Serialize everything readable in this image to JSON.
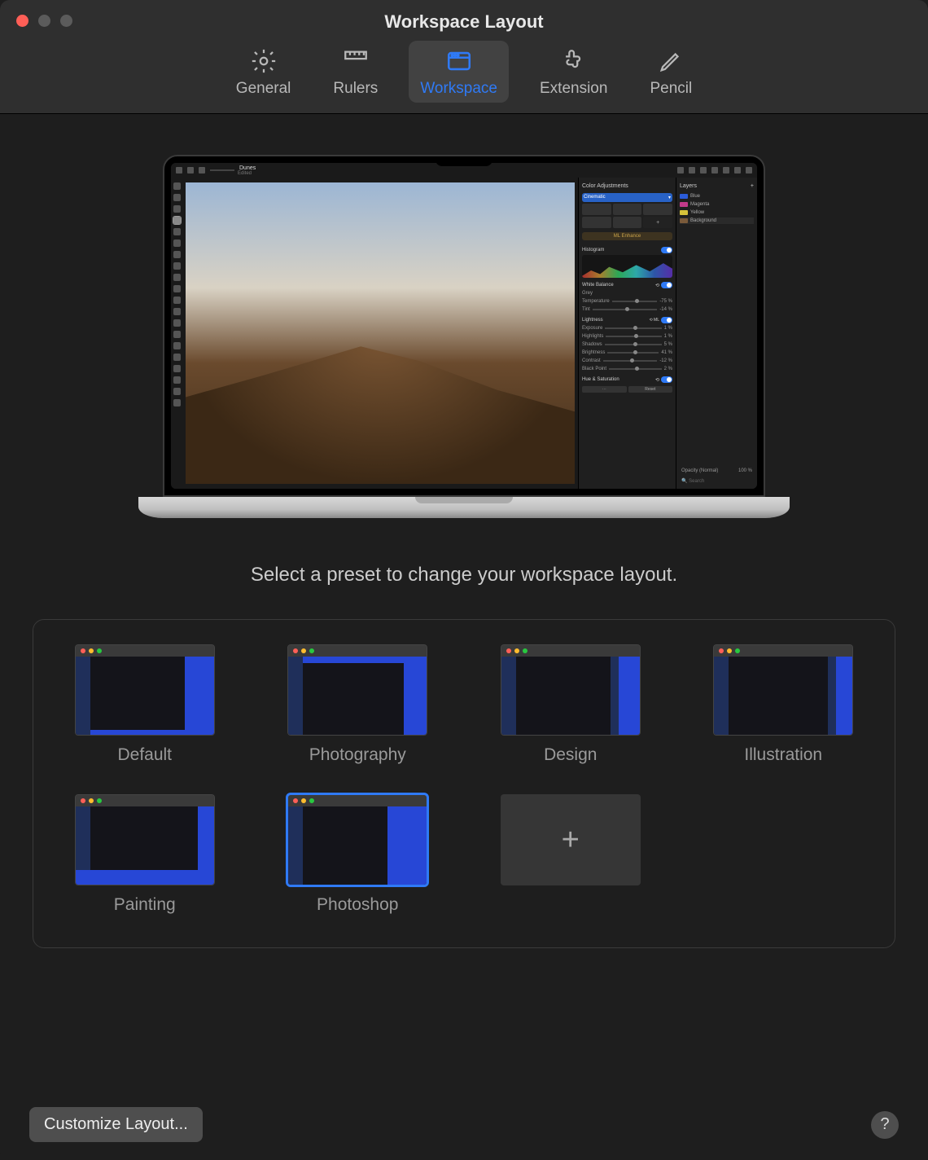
{
  "window": {
    "title": "Workspace Layout"
  },
  "tabs": [
    {
      "label": "General"
    },
    {
      "label": "Rulers"
    },
    {
      "label": "Workspace"
    },
    {
      "label": "Extension"
    },
    {
      "label": "Pencil"
    }
  ],
  "preview": {
    "doc_title": "Dunes",
    "doc_subtitle": "Edited",
    "panel_left_title": "Color Adjustments",
    "preset_name": "Cinematic",
    "ml_button": "ML Enhance",
    "histogram_title": "Histogram",
    "white_balance": "White Balance",
    "grey_label": "Grey",
    "temperature": {
      "label": "Temperature",
      "value": "-75 %"
    },
    "tint": {
      "label": "Tint",
      "value": "-14 %"
    },
    "lightness_title": "Lightness",
    "sliders": [
      {
        "label": "Exposure",
        "value": "1 %"
      },
      {
        "label": "Highlights",
        "value": "1 %"
      },
      {
        "label": "Shadows",
        "value": "5 %"
      },
      {
        "label": "Brightness",
        "value": "41 %"
      },
      {
        "label": "Contrast",
        "value": "-12 %"
      },
      {
        "label": "Black Point",
        "value": "2 %"
      }
    ],
    "hue_sat": "Hue & Saturation",
    "reset_label": "Reset",
    "layers_title": "Layers",
    "layers": [
      {
        "name": "Blue",
        "color": "#2b5bd8"
      },
      {
        "name": "Magenta",
        "color": "#c23a8a"
      },
      {
        "name": "Yellow",
        "color": "#d6c23a"
      },
      {
        "name": "Background",
        "color": "#7a5a3a"
      }
    ],
    "opacity_label": "Opacity (Normal)",
    "opacity_value": "100 %",
    "search_placeholder": "Search"
  },
  "instruction": "Select a preset to change your workspace layout.",
  "presets": [
    {
      "label": "Default"
    },
    {
      "label": "Photography"
    },
    {
      "label": "Design"
    },
    {
      "label": "Illustration"
    },
    {
      "label": "Painting"
    },
    {
      "label": "Photoshop"
    }
  ],
  "footer": {
    "customize": "Customize Layout...",
    "help": "?"
  },
  "colors": {
    "accent": "#2f7af6",
    "panel_blue": "#2747d6",
    "panel_blue_dark": "#1f2f5a"
  }
}
